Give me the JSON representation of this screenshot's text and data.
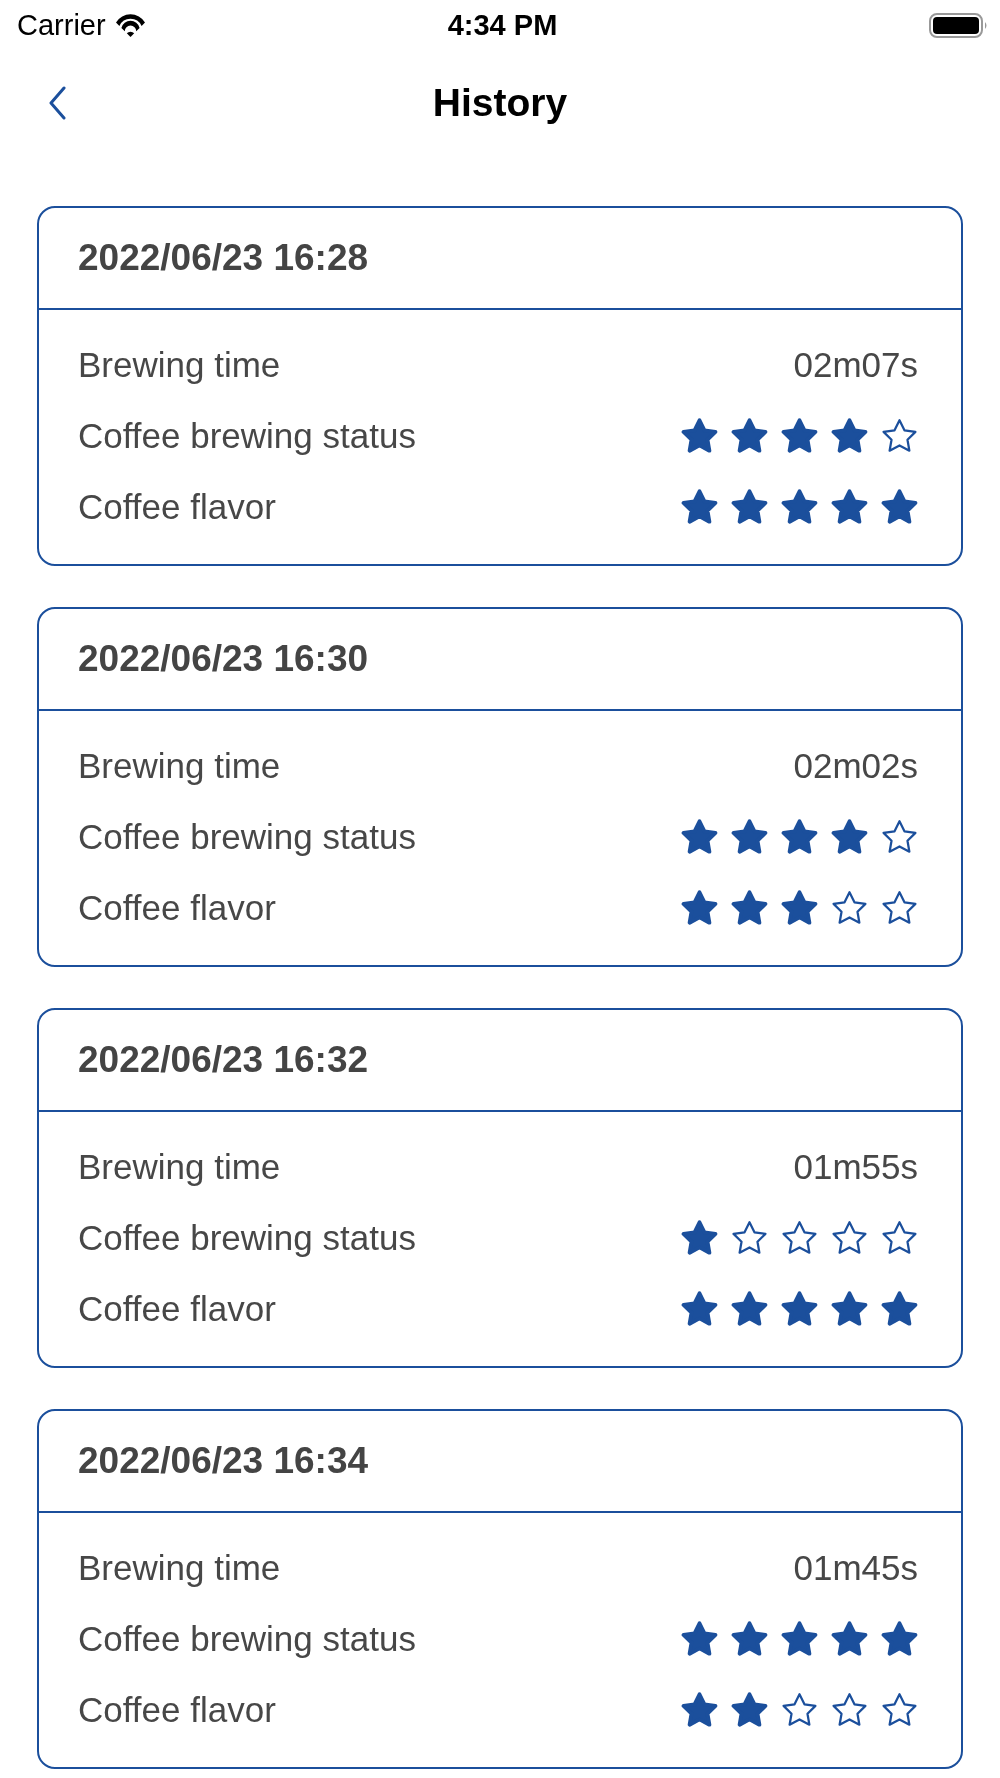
{
  "status_bar": {
    "carrier": "Carrier",
    "time": "4:34 PM"
  },
  "nav": {
    "title": "History"
  },
  "records": [
    {
      "datetime": "2022/06/23 16:28",
      "rows": [
        {
          "kind": "text",
          "label": "Brewing time",
          "value": "02m07s"
        },
        {
          "kind": "stars",
          "label": "Coffee brewing status",
          "stars": 4
        },
        {
          "kind": "stars",
          "label": "Coffee flavor",
          "stars": 5
        }
      ]
    },
    {
      "datetime": "2022/06/23 16:30",
      "rows": [
        {
          "kind": "text",
          "label": "Brewing time",
          "value": "02m02s"
        },
        {
          "kind": "stars",
          "label": "Coffee brewing status",
          "stars": 4
        },
        {
          "kind": "stars",
          "label": "Coffee flavor",
          "stars": 3
        }
      ]
    },
    {
      "datetime": "2022/06/23 16:32",
      "rows": [
        {
          "kind": "text",
          "label": "Brewing time",
          "value": "01m55s"
        },
        {
          "kind": "stars",
          "label": "Coffee brewing status",
          "stars": 1
        },
        {
          "kind": "stars",
          "label": "Coffee flavor",
          "stars": 5
        }
      ]
    },
    {
      "datetime": "2022/06/23 16:34",
      "rows": [
        {
          "kind": "text",
          "label": "Brewing time",
          "value": "01m45s"
        },
        {
          "kind": "stars",
          "label": "Coffee brewing status",
          "stars": 5
        },
        {
          "kind": "stars",
          "label": "Coffee flavor",
          "stars": 2
        }
      ]
    }
  ]
}
